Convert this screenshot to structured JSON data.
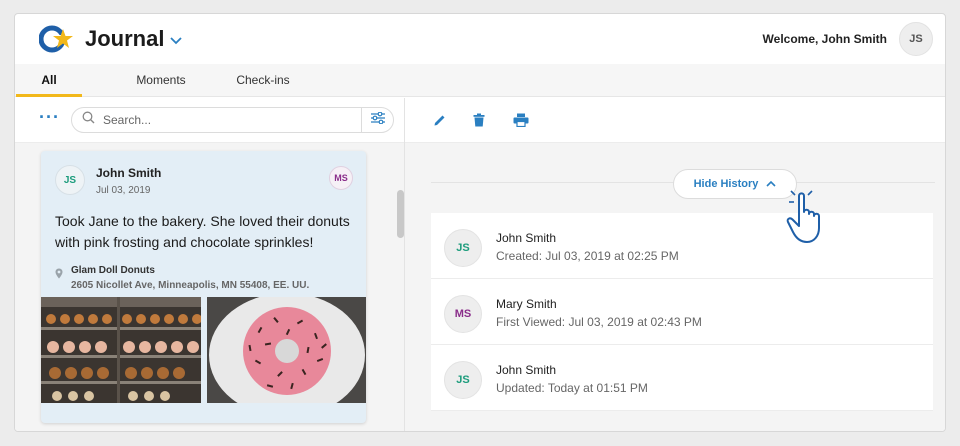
{
  "app": {
    "title": "Journal"
  },
  "header": {
    "welcome": "Welcome, John Smith",
    "avatar_initials": "JS"
  },
  "tabs": [
    {
      "label": "All",
      "active": true
    },
    {
      "label": "Moments",
      "active": false
    },
    {
      "label": "Check-ins",
      "active": false
    }
  ],
  "search": {
    "placeholder": "Search..."
  },
  "card": {
    "author_initials": "JS",
    "author": "John Smith",
    "date": "Jul 03, 2019",
    "shared_with_initials": "MS",
    "text": "Took Jane to the bakery. She loved their donuts with pink frosting and chocolate sprinkles!",
    "location_name": "Glam Doll Donuts",
    "location_address": "2605 Nicollet Ave, Minneapolis, MN 55408, EE. UU."
  },
  "history": {
    "toggle_label": "Hide History",
    "items": [
      {
        "initials": "JS",
        "name": "John Smith",
        "detail": "Created: Jul 03, 2019 at 02:25 PM"
      },
      {
        "initials": "MS",
        "name": "Mary Smith",
        "detail": "First Viewed: Jul 03, 2019 at 02:43 PM"
      },
      {
        "initials": "JS",
        "name": "John Smith",
        "detail": "Updated: Today at 01:51 PM"
      }
    ]
  },
  "colors": {
    "accent": "#2a7fc1",
    "tab_indicator": "#f2b81a",
    "card_bg": "#e3eef6",
    "js_initials": "#1c9c7c",
    "ms_initials": "#8a2d8a"
  }
}
